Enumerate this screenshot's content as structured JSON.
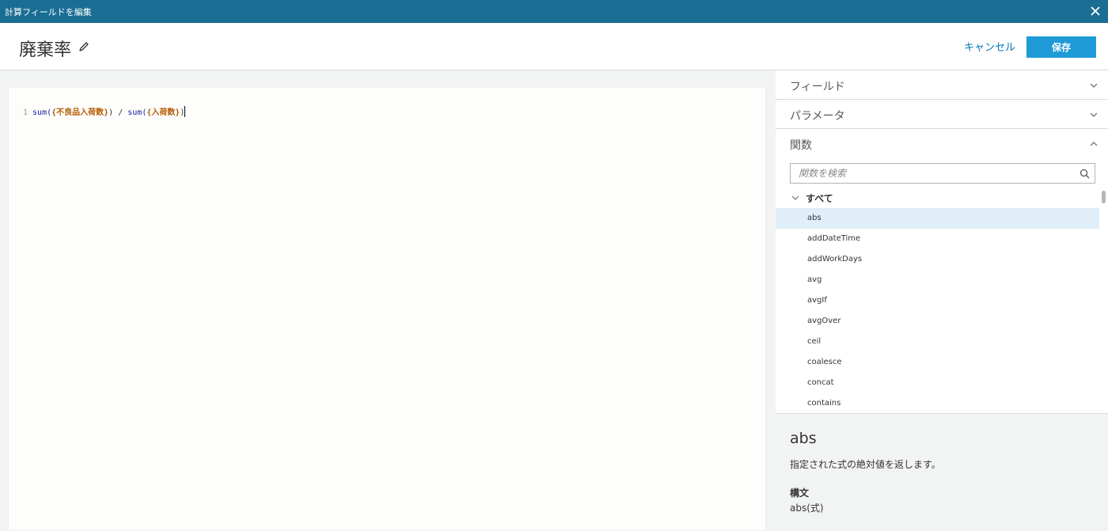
{
  "window": {
    "title": "計算フィールドを編集"
  },
  "header": {
    "field_name": "廃棄率",
    "cancel_label": "キャンセル",
    "save_label": "保存"
  },
  "editor": {
    "line_number": "1",
    "tokens": [
      {
        "text": "sum(",
        "kind": "fn"
      },
      {
        "text": "{不良品入荷数}",
        "kind": "fld"
      },
      {
        "text": ") / ",
        "kind": "op"
      },
      {
        "text": "sum(",
        "kind": "fn"
      },
      {
        "text": "{入荷数}",
        "kind": "fld"
      },
      {
        "text": ")",
        "kind": "op"
      }
    ]
  },
  "panel": {
    "sections": [
      {
        "label": "フィールド",
        "expanded": false
      },
      {
        "label": "パラメータ",
        "expanded": false
      },
      {
        "label": "関数",
        "expanded": true
      }
    ],
    "search": {
      "placeholder": "関数を検索",
      "value": ""
    },
    "group_label": "すべて",
    "functions": [
      "abs",
      "addDateTime",
      "addWorkDays",
      "avg",
      "avgIf",
      "avgOver",
      "ceil",
      "coalesce",
      "concat",
      "contains"
    ],
    "selected_function": "abs",
    "detail": {
      "name": "abs",
      "description": "指定された式の絶対値を返します。",
      "syntax_label": "構文",
      "syntax": "abs(式)"
    }
  },
  "colors": {
    "titlebar": "#1a6e94",
    "save_button": "#1e9bd7",
    "link": "#0073bb",
    "selected_row": "#dfeef8"
  },
  "icons": [
    "close-icon",
    "pencil-icon",
    "chevron-down-icon",
    "chevron-up-icon",
    "search-icon"
  ]
}
